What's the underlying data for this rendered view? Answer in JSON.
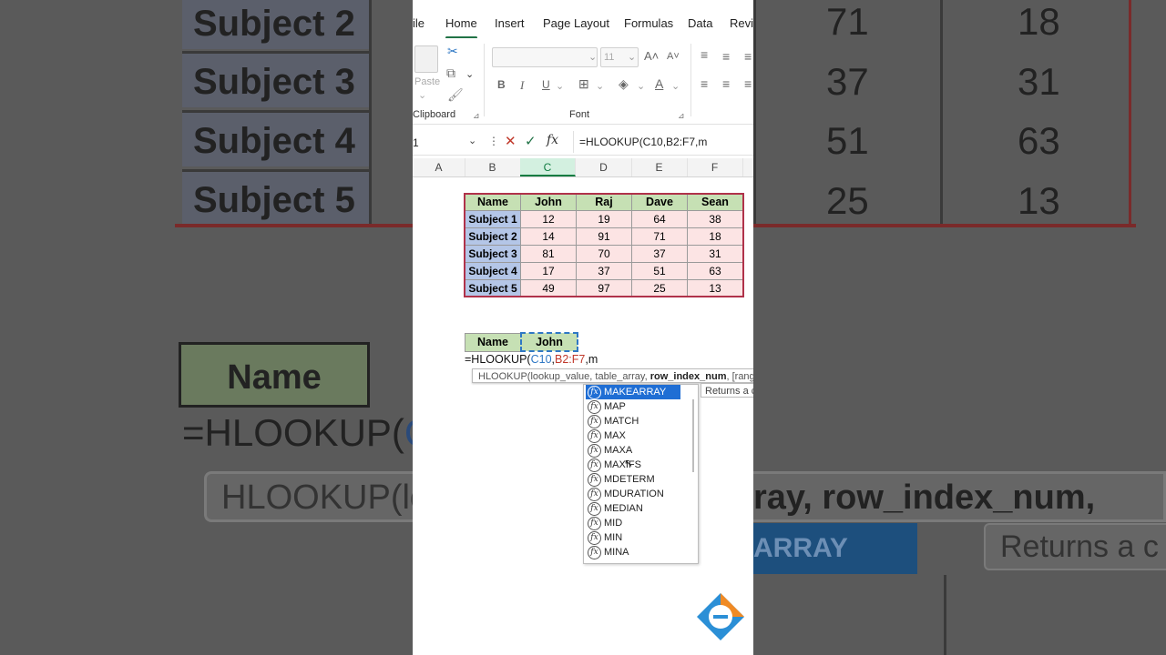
{
  "background": {
    "subjects": [
      "Subject 2",
      "Subject 3",
      "Subject 4",
      "Subject 5"
    ],
    "col1_values": [
      "71",
      "37",
      "51",
      "25"
    ],
    "col2_values": [
      "18",
      "31",
      "63",
      "13"
    ],
    "name_header": "Name",
    "formula_fragment": "=HLOOKUP(",
    "formula_ref": "C",
    "tooltip_fragment": "HLOOKUP(lo",
    "tooltip_right": "ray, row_index_num, [rang",
    "active_fragment": "ARRAY",
    "returns_fragment": "Returns a c"
  },
  "ribbon": {
    "tabs": [
      "ile",
      "Home",
      "Insert",
      "Page Layout",
      "Formulas",
      "Data",
      "Revie"
    ],
    "active_tab": "Home",
    "clipboard_label": "Clipboard",
    "paste_label": "Paste",
    "font_label": "Font",
    "font_size": "11",
    "bold": "B",
    "italic": "I",
    "underline": "U"
  },
  "formula_bar": {
    "name_box": "1",
    "fx": "fx",
    "formula": "=HLOOKUP(C10,B2:F7,m"
  },
  "columns": [
    "A",
    "B",
    "C",
    "D",
    "E",
    "F"
  ],
  "selected_column": "C",
  "table": {
    "headers": [
      "Name",
      "John",
      "Raj",
      "Dave",
      "Sean"
    ],
    "rows": [
      {
        "name": "Subject 1",
        "values": [
          "12",
          "19",
          "64",
          "38"
        ]
      },
      {
        "name": "Subject 2",
        "values": [
          "14",
          "91",
          "71",
          "18"
        ]
      },
      {
        "name": "Subject 3",
        "values": [
          "81",
          "70",
          "37",
          "31"
        ]
      },
      {
        "name": "Subject 4",
        "values": [
          "17",
          "37",
          "51",
          "63"
        ]
      },
      {
        "name": "Subject 5",
        "values": [
          "49",
          "97",
          "25",
          "13"
        ]
      }
    ]
  },
  "lookup": {
    "name_label": "Name",
    "name_value": "John",
    "formula_prefix": "=HLOOKUP(",
    "ref1": "C10",
    "comma1": ",",
    "ref2": "B2:F7",
    "suffix": ",m"
  },
  "tooltip": {
    "prefix": "HLOOKUP(lookup_value, table_array, ",
    "bold_arg": "row_index_num",
    "suffix": ", [rang"
  },
  "returns_text": "Returns a c",
  "autocomplete": [
    "MAKEARRAY",
    "MAP",
    "MATCH",
    "MAX",
    "MAXA",
    "MAXIFS",
    "MDETERM",
    "MDURATION",
    "MEDIAN",
    "MID",
    "MIN",
    "MINA"
  ],
  "autocomplete_active": "MAKEARRAY",
  "colors": {
    "header_green": "#c6e0b4",
    "row_blue": "#b4c6e7",
    "value_pink": "#fce4e4",
    "table_border": "#b0324a",
    "excel_green": "#217346"
  }
}
